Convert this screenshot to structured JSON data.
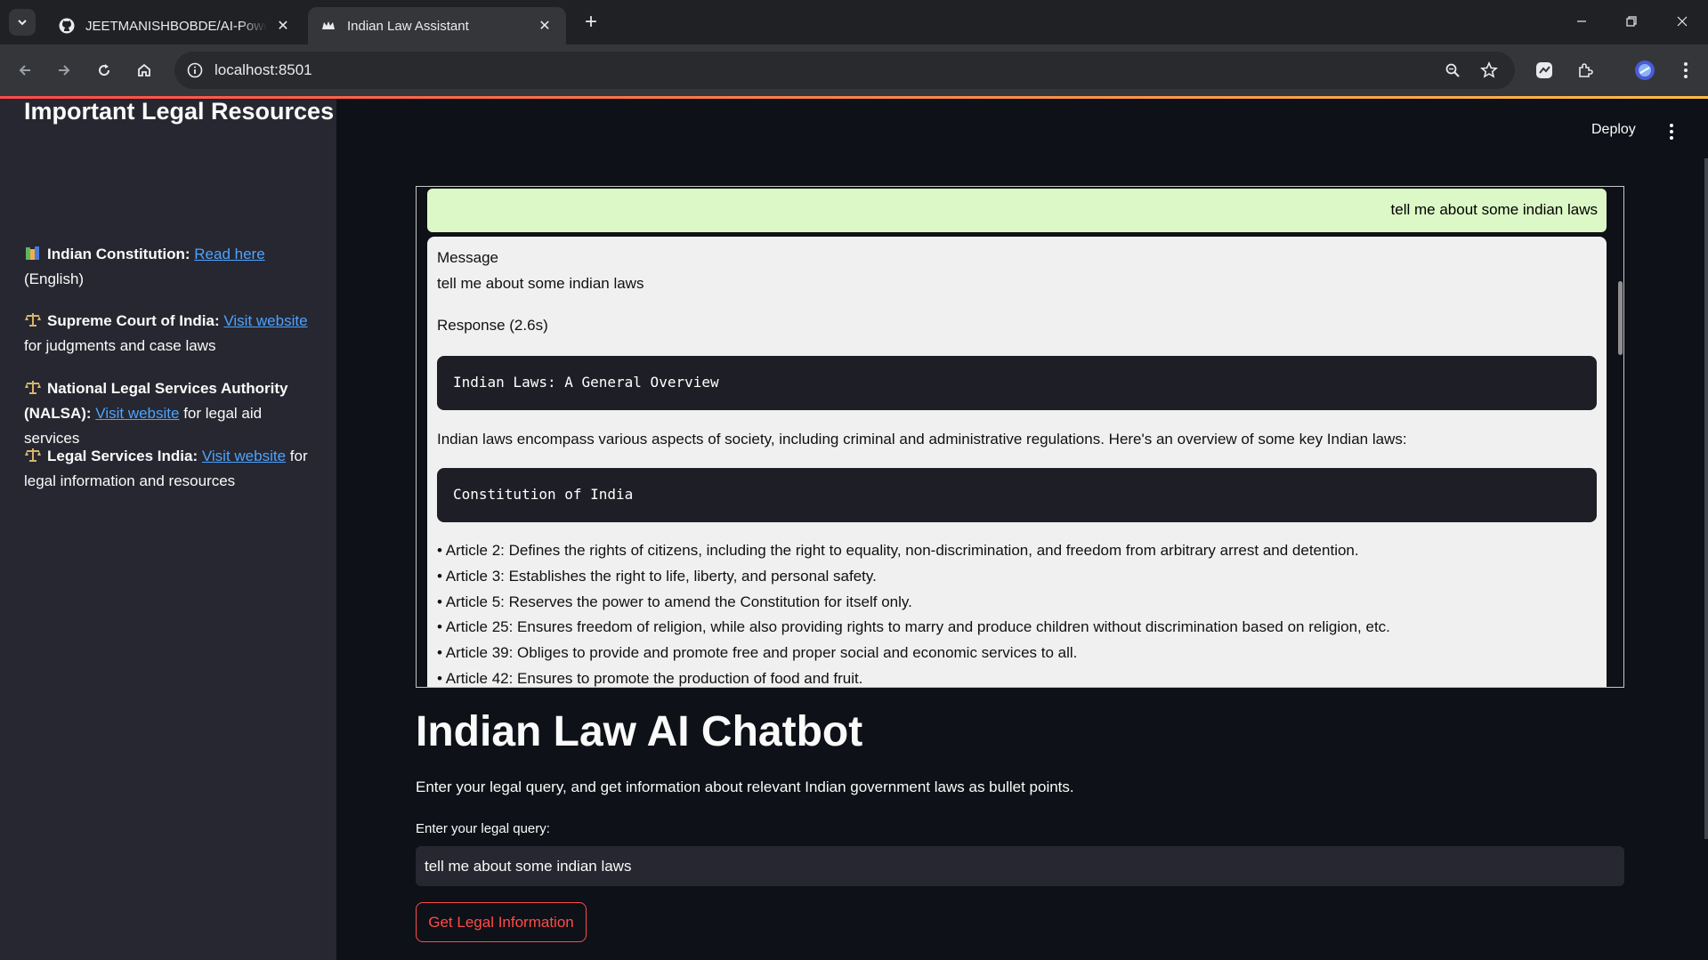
{
  "browser": {
    "tabs": [
      {
        "title": "JEETMANISHBOBDE/AI-Powered",
        "active": false
      },
      {
        "title": "Indian Law Assistant",
        "active": true
      }
    ],
    "url": "localhost:8501"
  },
  "header": {
    "deploy_label": "Deploy"
  },
  "sidebar": {
    "title": "Important Legal Resources",
    "resources": [
      {
        "name": "Indian Constitution:",
        "link": "Read here",
        "after": " (English)"
      },
      {
        "name": "Supreme Court of India:",
        "link": "Visit website",
        "after": " for judgments and case laws"
      },
      {
        "name": "National Legal Services Authority (NALSA):",
        "link": "Visit website",
        "after": " for legal aid services"
      },
      {
        "name": "Legal Services India:",
        "link": "Visit website",
        "after": " for legal information and resources"
      }
    ]
  },
  "chat": {
    "user_message": "tell me about some indian laws",
    "message_label": "Message",
    "message_text": "tell me about some indian laws",
    "response_label": "Response (2.6s)",
    "heading1": "Indian Laws: A General Overview",
    "intro": "Indian laws encompass various aspects of society, including criminal and administrative regulations. Here's an overview of some key Indian laws:",
    "heading2": "Constitution of India",
    "bullets": [
      "• Article 2: Defines the rights of citizens, including the right to equality, non-discrimination, and freedom from arbitrary arrest and detention.",
      "• Article 3: Establishes the right to life, liberty, and personal safety.",
      "• Article 5: Reserves the power to amend the Constitution for itself only.",
      "• Article 25: Ensures freedom of religion, while also providing rights to marry and produce children without discrimination based on religion, etc.",
      "• Article 39: Obliges to provide and promote free and proper social and economic services to all.",
      "• Article 42: Ensures to promote the production of food and fruit."
    ]
  },
  "main": {
    "title": "Indian Law AI Chatbot",
    "subtitle": "Enter your legal query, and get information about relevant Indian government laws as bullet points.",
    "query_label": "Enter your legal query:",
    "query_value": "tell me about some indian laws",
    "submit_label": "Get Legal Information"
  }
}
